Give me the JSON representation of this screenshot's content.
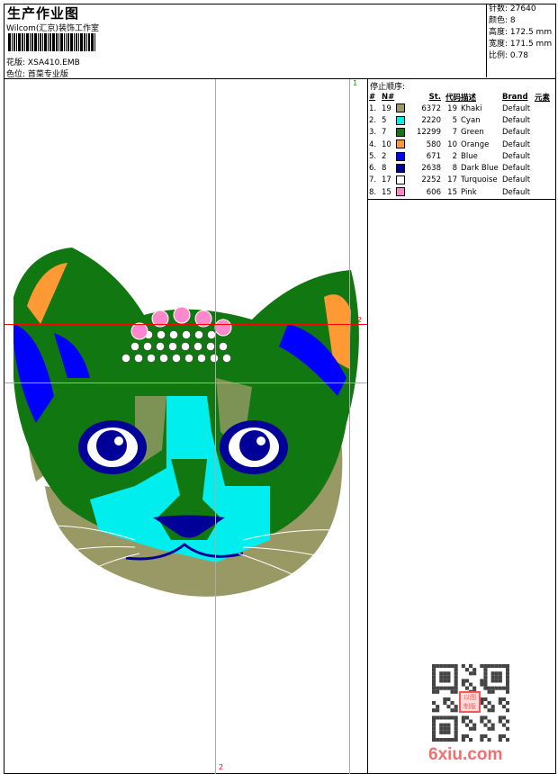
{
  "header": {
    "title": "生产作业图",
    "company": "Wilcom(汇京)装饰工作室",
    "file_label": "花版:",
    "file_value": "XSA410.EMB",
    "colorway_label": "色位:",
    "colorway_value": "首菜专业版"
  },
  "info": {
    "stitches_label": "针数:",
    "stitches": "27640",
    "colors_label": "颜色:",
    "colors": "8",
    "height_label": "高度:",
    "height": "172.5 mm",
    "width_label": "宽度:",
    "width": "171.5 mm",
    "scale_label": "比例:",
    "scale": "0.78"
  },
  "stop_sequence": {
    "title": "停止顺序:",
    "headers": [
      "#",
      "N#",
      "St.",
      "代码",
      "描述",
      "Brand",
      "元素"
    ],
    "rows": [
      {
        "idx": "1.",
        "n": "19",
        "color": "#999966",
        "st": "6372",
        "code": "19",
        "desc": "Khaki",
        "brand": "Default"
      },
      {
        "idx": "2.",
        "n": "5",
        "color": "#00eeee",
        "st": "2220",
        "code": "5",
        "desc": "Cyan",
        "brand": "Default"
      },
      {
        "idx": "3.",
        "n": "7",
        "color": "#117711",
        "st": "12299",
        "code": "7",
        "desc": "Green",
        "brand": "Default"
      },
      {
        "idx": "4.",
        "n": "10",
        "color": "#ff9933",
        "st": "580",
        "code": "10",
        "desc": "Orange",
        "brand": "Default"
      },
      {
        "idx": "5.",
        "n": "2",
        "color": "#0000ff",
        "st": "671",
        "code": "2",
        "desc": "Blue",
        "brand": "Default"
      },
      {
        "idx": "6.",
        "n": "8",
        "color": "#000099",
        "st": "2638",
        "code": "8",
        "desc": "Dark Blue",
        "brand": "Default"
      },
      {
        "idx": "7.",
        "n": "17",
        "color": "#ffffff",
        "st": "2252",
        "code": "17",
        "desc": "Turquoise",
        "brand": "Default"
      },
      {
        "idx": "8.",
        "n": "15",
        "color": "#ff88cc",
        "st": "606",
        "code": "15",
        "desc": "Pink",
        "brand": "Default"
      }
    ]
  },
  "markers": {
    "start": "1",
    "end_bottom": "2",
    "end_right": "2"
  },
  "watermark": {
    "site": "6xiu.com",
    "stamp": "以图制版"
  }
}
